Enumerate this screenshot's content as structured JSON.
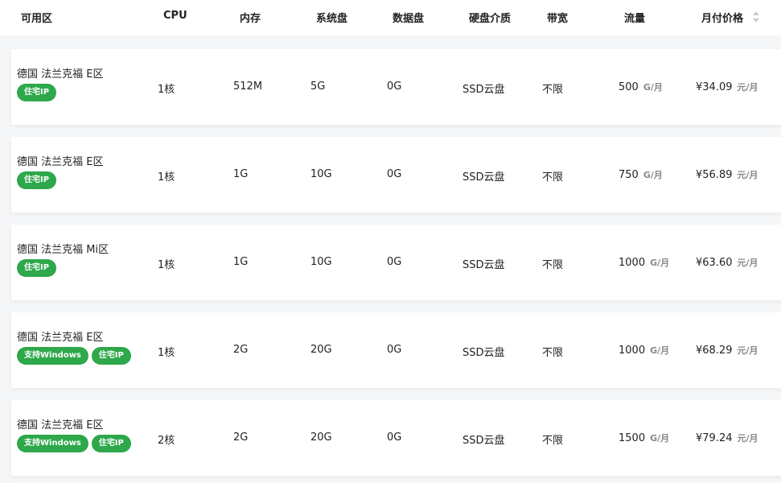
{
  "header": {
    "zone": "可用区",
    "cpu": "CPU",
    "memory": "内存",
    "system_disk": "系统盘",
    "data_disk": "数据盘",
    "disk_media": "硬盘介质",
    "bandwidth": "带宽",
    "traffic": "流量",
    "monthly_price": "月付价格"
  },
  "rows": [
    {
      "region": "德国 法兰克福 E区",
      "badges": [
        "住宅IP"
      ],
      "cpu": "1核",
      "memory": "512M",
      "system_disk": "5G",
      "data_disk": "0G",
      "disk_media": "SSD云盘",
      "bandwidth": "不限",
      "traffic": "500",
      "traffic_unit": "G/月",
      "price": "¥34.09",
      "price_unit": "元/月"
    },
    {
      "region": "德国 法兰克福 E区",
      "badges": [
        "住宅IP"
      ],
      "cpu": "1核",
      "memory": "1G",
      "system_disk": "10G",
      "data_disk": "0G",
      "disk_media": "SSD云盘",
      "bandwidth": "不限",
      "traffic": "750",
      "traffic_unit": "G/月",
      "price": "¥56.89",
      "price_unit": "元/月"
    },
    {
      "region": "德国 法兰克福 Mi区",
      "badges": [
        "住宅IP"
      ],
      "cpu": "1核",
      "memory": "1G",
      "system_disk": "10G",
      "data_disk": "0G",
      "disk_media": "SSD云盘",
      "bandwidth": "不限",
      "traffic": "1000",
      "traffic_unit": "G/月",
      "price": "¥63.60",
      "price_unit": "元/月"
    },
    {
      "region": "德国 法兰克福 E区",
      "badges": [
        "支持Windows",
        "住宅IP"
      ],
      "cpu": "1核",
      "memory": "2G",
      "system_disk": "20G",
      "data_disk": "0G",
      "disk_media": "SSD云盘",
      "bandwidth": "不限",
      "traffic": "1000",
      "traffic_unit": "G/月",
      "price": "¥68.29",
      "price_unit": "元/月"
    },
    {
      "region": "德国 法兰克福 E区",
      "badges": [
        "支持Windows",
        "住宅IP"
      ],
      "cpu": "2核",
      "memory": "2G",
      "system_disk": "20G",
      "data_disk": "0G",
      "disk_media": "SSD云盘",
      "bandwidth": "不限",
      "traffic": "1500",
      "traffic_unit": "G/月",
      "price": "¥79.24",
      "price_unit": "元/月"
    }
  ],
  "colors": {
    "badge": "#2ea84a",
    "background": "#f5f6f8"
  },
  "icons": {
    "sort": "sort-icon"
  }
}
